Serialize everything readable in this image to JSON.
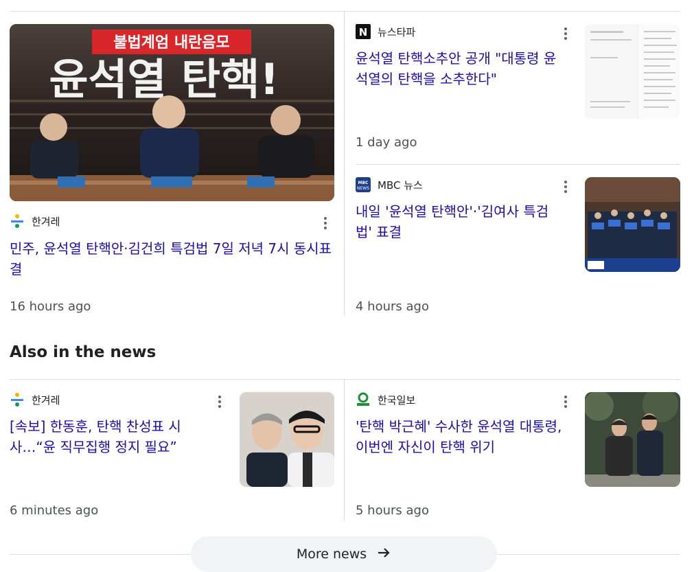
{
  "top_stories": [
    {
      "source": "한겨레",
      "source_icon": "hankyoreh-logo",
      "title": "민주, 윤석열 탄핵안·김건희 특검법 7일 저녁 7시 동시표결",
      "time": "16 hours ago",
      "image_text": {
        "banner": "불법계엄 내란음모",
        "headline": "윤석열 탄핵!"
      }
    },
    {
      "source": "뉴스타파",
      "source_icon": "newstapa-logo",
      "title": "윤석열 탄핵소추안 공개 \"대통령 윤석열의 탄핵을 소추한다\"",
      "time": "1 day ago"
    },
    {
      "source": "MBC 뉴스",
      "source_icon": "mbc-news-logo",
      "title": "내일 '윤석열 탄핵안'·'김여사 특검법' 표결",
      "time": "4 hours ago"
    }
  ],
  "also_in_news": {
    "heading": "Also in the news",
    "items": [
      {
        "source": "한겨레",
        "source_icon": "hankyoreh-logo",
        "title": "[속보] 한동훈, 탄핵 찬성표 시사…“윤 직무집행 정지 필요”",
        "time": "6 minutes ago"
      },
      {
        "source": "한국일보",
        "source_icon": "hankookilbo-logo",
        "title": "'탄핵 박근혜' 수사한 윤석열 대통령, 이번엔 자신이 탄핵 위기",
        "time": "5 hours ago"
      }
    ]
  },
  "more_news": {
    "label": "More news",
    "icon": "arrow-right-icon"
  },
  "colors": {
    "link": "#1a0dab",
    "divider": "#dadce0",
    "time": "#4d5156"
  }
}
